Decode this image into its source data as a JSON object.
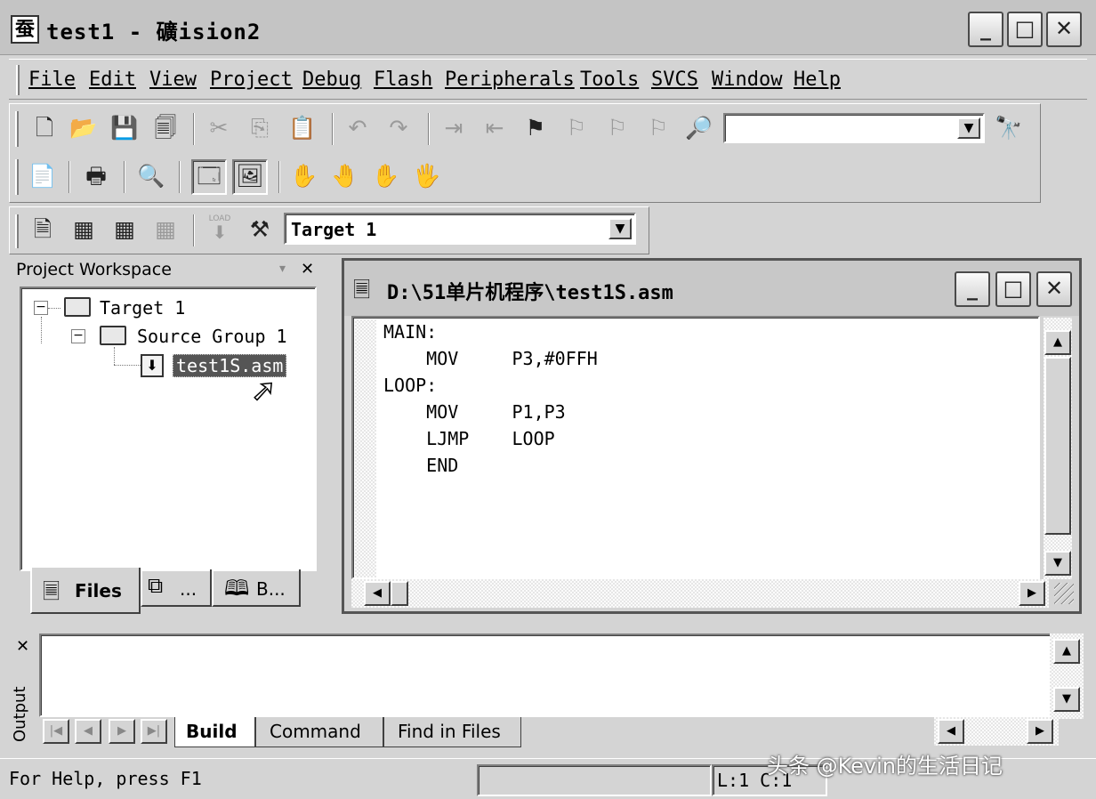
{
  "window": {
    "title": "test1  - 礦ision2",
    "icon_glyph": "蚕"
  },
  "title_buttons": {
    "minimize": "_",
    "maximize": "□",
    "close": "✕"
  },
  "menu": [
    "File",
    "Edit",
    "View",
    "Project",
    "Debug",
    "Flash",
    "Peripherals",
    "Tools",
    "SVCS",
    "Window",
    "Help"
  ],
  "toolbar1_icons": [
    "new-file-icon",
    "open-icon",
    "save-icon",
    "save-all-icon",
    "cut-icon",
    "copy-icon",
    "paste-icon",
    "undo-icon",
    "redo-icon",
    "indent-icon",
    "unindent-icon",
    "bookmark-icon",
    "next-bookmark-icon",
    "prev-bookmark-icon",
    "clear-bookmark-icon",
    "find-in-files-icon",
    "find-icon"
  ],
  "toolbar1": {
    "search_value": ""
  },
  "toolbar2_icons": [
    "open-file-icon",
    "print-icon",
    "debug-icon",
    "workspace-window-icon",
    "output-window-icon",
    "hand-icon",
    "hand-grab-icon",
    "hand-dim-icon",
    "hand-stop-icon"
  ],
  "toolbar3": {
    "target": "Target 1",
    "load_label": "LOAD",
    "icons": [
      "translate-icon",
      "build-icon",
      "rebuild-icon",
      "stop-build-icon",
      "download-icon",
      "target-options-icon"
    ]
  },
  "workspace": {
    "title": "Project Workspace",
    "tree": {
      "target": "Target 1",
      "group": "Source Group 1",
      "file": "test1S.asm"
    },
    "tabs": {
      "files": "Files",
      "regs": "...",
      "books": "B..."
    }
  },
  "editor": {
    "title": "D:\\51单片机程序\\test1S.asm",
    "lines": [
      "MAIN:",
      "    MOV     P3,#0FFH",
      "LOOP:",
      "    MOV     P1,P3",
      "    LJMP    LOOP",
      "    END"
    ]
  },
  "output": {
    "side_label": "Output",
    "tabs": {
      "build": "Build",
      "command": "Command",
      "find": "Find in Files"
    }
  },
  "status": {
    "help": "For Help, press F1",
    "position": "L:1 C:1"
  },
  "watermark": "头条 @Kevin的生活日记"
}
